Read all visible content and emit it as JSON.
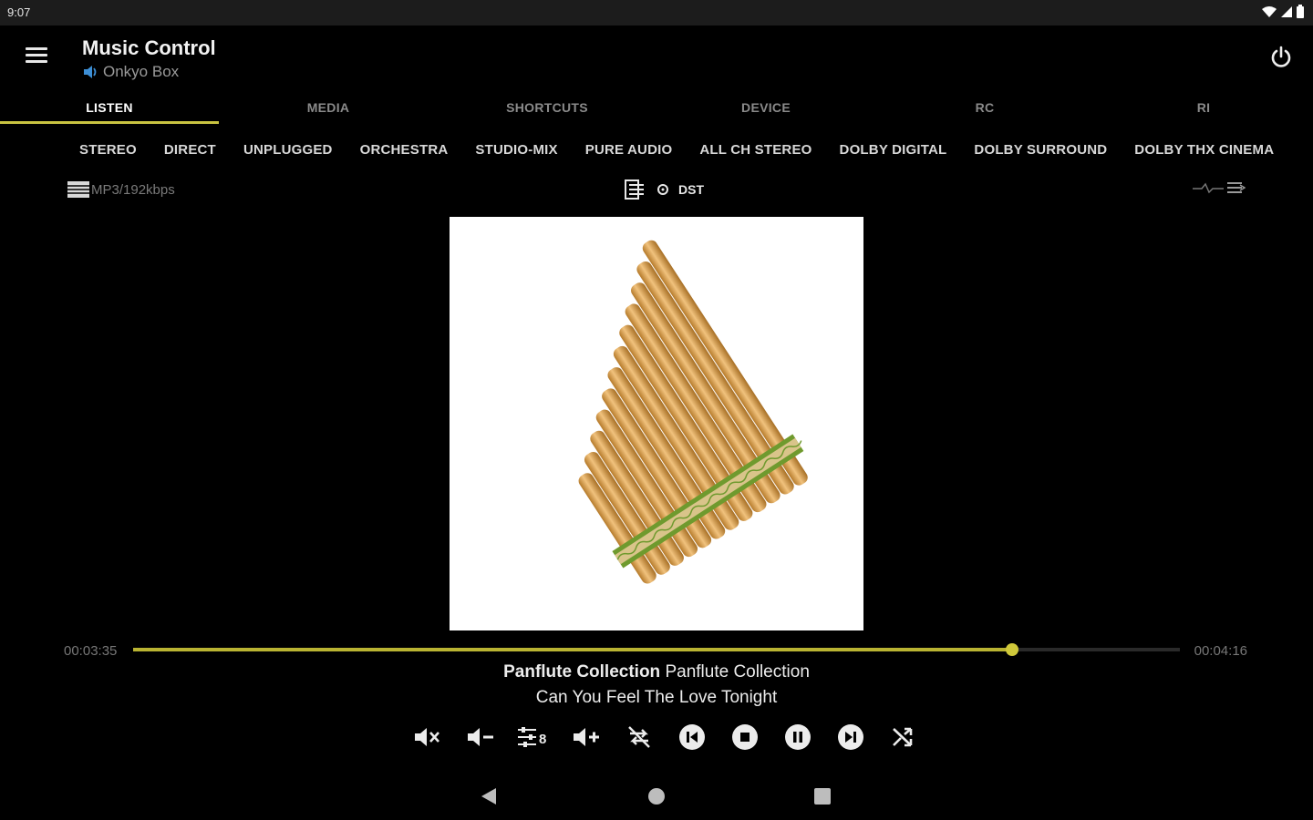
{
  "status_bar": {
    "time": "9:07"
  },
  "app": {
    "title": "Music Control",
    "device": "Onkyo Box"
  },
  "tabs": [
    {
      "label": "LISTEN",
      "active": true
    },
    {
      "label": "MEDIA",
      "active": false
    },
    {
      "label": "SHORTCUTS",
      "active": false
    },
    {
      "label": "DEVICE",
      "active": false
    },
    {
      "label": "RC",
      "active": false
    },
    {
      "label": "RI",
      "active": false
    }
  ],
  "listening_modes": [
    "STEREO",
    "DIRECT",
    "UNPLUGGED",
    "ORCHESTRA",
    "STUDIO-MIX",
    "PURE AUDIO",
    "ALL CH STEREO",
    "DOLBY DIGITAL",
    "DOLBY SURROUND",
    "DOLBY THX CINEMA"
  ],
  "info_row": {
    "format": "MP3/192kbps",
    "center": "DST"
  },
  "playback": {
    "elapsed": "00:03:35",
    "total": "00:04:16",
    "progress_fraction": 0.84,
    "album_primary": "Panflute Collection",
    "album_secondary": "Panflute Collection",
    "track_title": "Can You Feel The Love Tonight",
    "tone_value": "8"
  },
  "colors": {
    "accent": "#c9c441",
    "background": "#000000"
  },
  "icons": {
    "controls": [
      "mute-icon",
      "volume-down-icon",
      "tone-control-icon",
      "volume-up-icon",
      "repeat-off-icon",
      "previous-track-icon",
      "stop-icon",
      "pause-icon",
      "next-track-icon",
      "shuffle-icon"
    ]
  }
}
